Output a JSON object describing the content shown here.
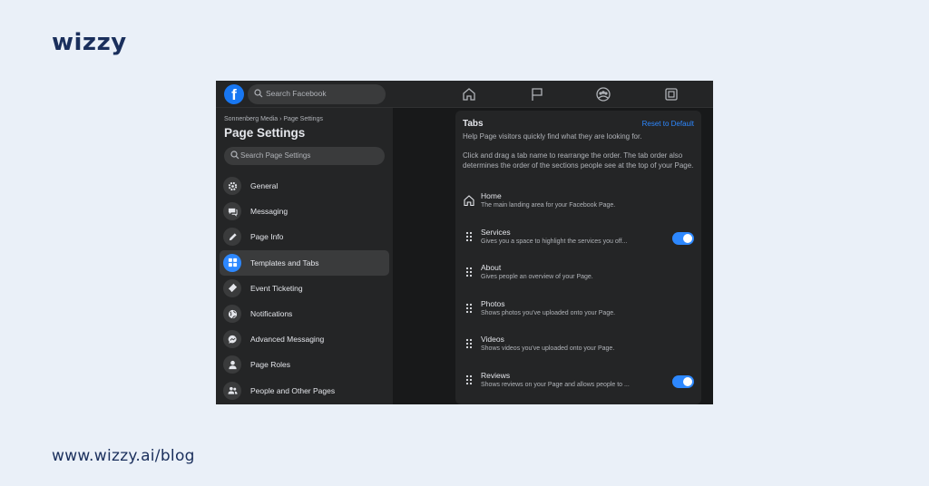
{
  "brand": {
    "logo": "wizzy",
    "url": "www.wizzy.ai/blog"
  },
  "topbar": {
    "logo": "f",
    "search_placeholder": "Search Facebook"
  },
  "sidebar": {
    "breadcrumb": "Sonnenberg Media › Page Settings",
    "title": "Page Settings",
    "search_placeholder": "Search Page Settings",
    "items": [
      {
        "label": "General",
        "icon": "gear-icon",
        "active": false
      },
      {
        "label": "Messaging",
        "icon": "chat-icon",
        "active": false
      },
      {
        "label": "Page Info",
        "icon": "pencil-icon",
        "active": false
      },
      {
        "label": "Templates and Tabs",
        "icon": "grid-icon",
        "active": true
      },
      {
        "label": "Event Ticketing",
        "icon": "ticket-icon",
        "active": false
      },
      {
        "label": "Notifications",
        "icon": "globe-icon",
        "active": false
      },
      {
        "label": "Advanced Messaging",
        "icon": "messenger-icon",
        "active": false
      },
      {
        "label": "Page Roles",
        "icon": "person-icon",
        "active": false
      },
      {
        "label": "People and Other Pages",
        "icon": "people-icon",
        "active": false
      }
    ]
  },
  "panel": {
    "title": "Tabs",
    "reset_label": "Reset to Default",
    "desc1": "Help Page visitors quickly find what they are looking for.",
    "desc2": "Click and drag a tab name to rearrange the order. The tab order also determines the order of the sections people see at the top of your Page.",
    "tabs": [
      {
        "name": "Home",
        "sub": "The main landing area for your Facebook Page.",
        "toggle": false
      },
      {
        "name": "Services",
        "sub": "Gives you a space to highlight the services you off...",
        "toggle": true
      },
      {
        "name": "About",
        "sub": "Gives people an overview of your Page.",
        "toggle": false
      },
      {
        "name": "Photos",
        "sub": "Shows photos you've uploaded onto your Page.",
        "toggle": false
      },
      {
        "name": "Videos",
        "sub": "Shows videos you've uploaded onto your Page.",
        "toggle": false
      },
      {
        "name": "Reviews",
        "sub": "Shows reviews on your Page and allows people to ...",
        "toggle": true
      }
    ]
  },
  "colors": {
    "accent": "#2d88ff",
    "brand_navy": "#1a2f5c",
    "background": "#eaf0f8"
  }
}
